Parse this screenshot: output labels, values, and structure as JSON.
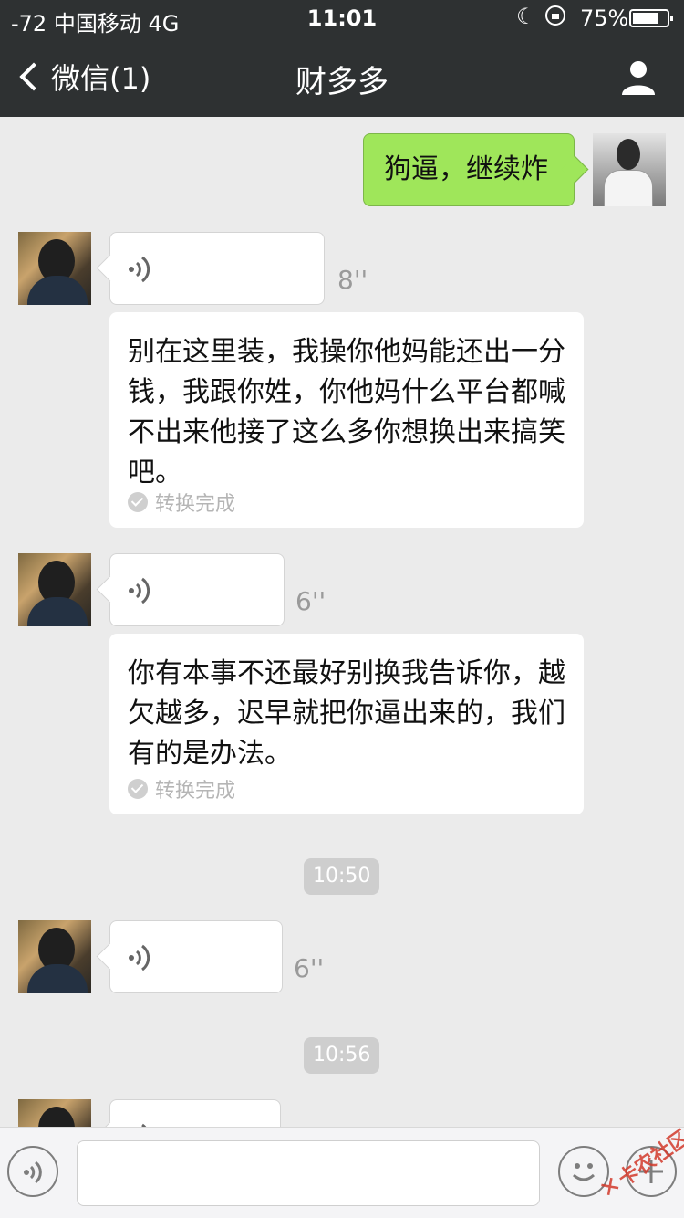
{
  "status_bar": {
    "carrier": "-72 中国移动  4G",
    "time": "11:01",
    "battery": "75%",
    "battery_level": 0.75
  },
  "nav": {
    "back_label": "微信(1)",
    "title": "财多多",
    "user_icon": "person-icon"
  },
  "messages": {
    "sent_1": "狗逼，继续炸",
    "voice_1_duration": "8''",
    "transcript_1": "别在这里装，我操你他妈能还出一分钱，我跟你姓，你他妈什么平台都喊不出来他接了这么多你想换出来搞笑吧。",
    "transcript_1_status": "转换完成",
    "voice_2_duration": "6''",
    "transcript_2": "你有本事不还最好别换我告诉你，越欠越多，迟早就把你逼出来的，我们有的是办法。",
    "transcript_2_status": "转换完成",
    "time_1": "10:50",
    "voice_3_duration": "6''",
    "time_2": "10:56"
  },
  "input_bar": {
    "value": "",
    "voice_icon": "voice-icon",
    "emoji_icon": "emoji-icon",
    "plus_icon": "plus-icon"
  },
  "watermark": "卡农社区",
  "colors": {
    "nav_bg": "#2e3132",
    "sent_bubble": "#9fe65a",
    "chat_bg": "#ebebeb"
  }
}
